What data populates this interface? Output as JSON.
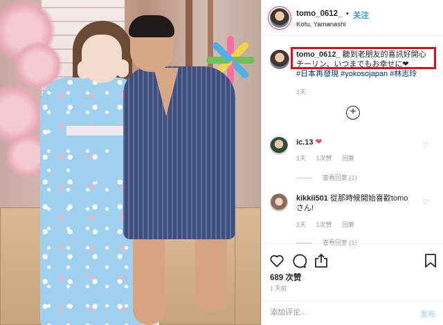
{
  "post": {
    "username": "tomo_0612_",
    "separator": "•",
    "follow_label": "关注",
    "location": "Kofu, Yamanashi"
  },
  "caption": {
    "username": "tomo_0612_",
    "line1": "聽到老朋友的喜訊好開心",
    "line2": "チーリン、いつまでもお幸せに",
    "line2_icon": "black-heart-icon",
    "hashtags": "#日本再發現 #yokosojapan #林志玲",
    "time": "1天"
  },
  "comments": [
    {
      "username": "ic.13",
      "text": "",
      "emoji": "red-heart-icon",
      "time": "1天",
      "likes": "1次赞",
      "reply": "回复",
      "view_replies": "查看回复 (1)"
    },
    {
      "username": "kikkii501",
      "text": "從那時候開始喜歡tomo",
      "text2": "さん!",
      "time": "1天",
      "likes": "1次赞",
      "reply": "回复",
      "view_replies": "查看回复 (1)"
    }
  ],
  "actions": {
    "likes": "689 次赞",
    "posted": "1 天前",
    "comment_placeholder": "添加评论...",
    "post_label": "发布"
  },
  "colors": {
    "link": "#3897f0",
    "highlight_box": "#e10d1a",
    "heart": "#ed4956"
  }
}
